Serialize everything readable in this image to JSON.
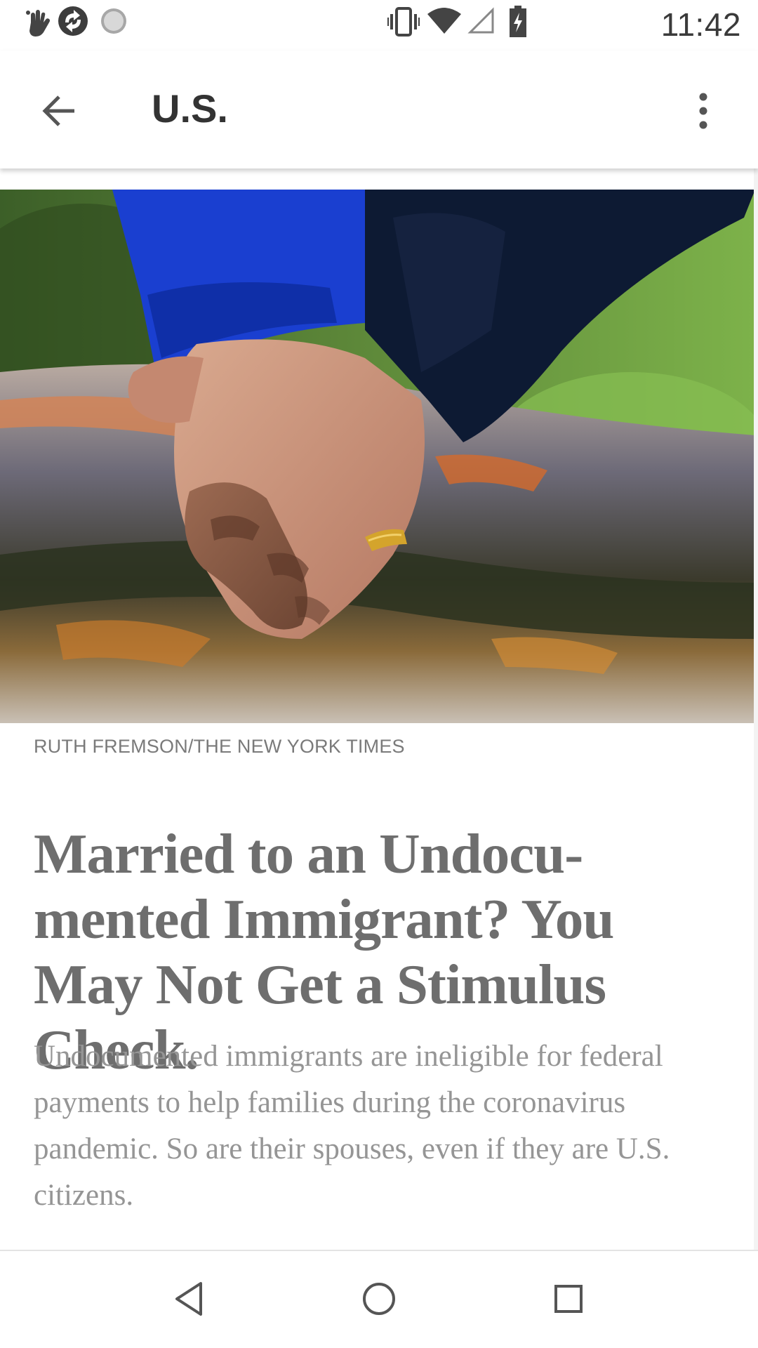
{
  "status_bar": {
    "time": "11:42",
    "left_icons": [
      "hand-gesture-icon",
      "app-sync-icon",
      "loading-circle-icon"
    ],
    "right_icons": [
      "vibrate-icon",
      "wifi-icon",
      "cell-signal-icon",
      "battery-charging-icon"
    ]
  },
  "app_bar": {
    "title": "U.S.",
    "back_icon": "arrow-back-icon",
    "menu_icon": "more-vert-icon"
  },
  "article": {
    "image_description_icon": "holding-hands-photo",
    "photo_credit": "RUTH FREMSON/THE NEW YORK TIMES",
    "headline": "Married to an Undocu-mented Immigrant? You May Not Get a Stimulus Check.",
    "summary": "Undocumented immigrants are ineligible for federal payments to help families during the coronavirus pandemic. So are their spouses, even if they are U.S. citizens."
  },
  "nav_bar": {
    "back_icon": "nav-back-triangle-icon",
    "home_icon": "nav-home-circle-icon",
    "recents_icon": "nav-recents-square-icon"
  },
  "colors": {
    "headline": "#6e6e6e",
    "summary": "#959595",
    "credit": "#7a7a7a",
    "title": "#333333"
  }
}
